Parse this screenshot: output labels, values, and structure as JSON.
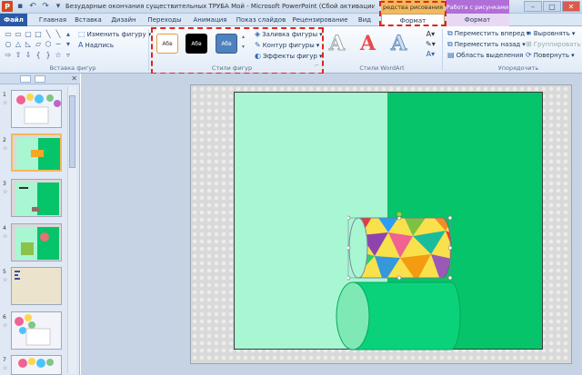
{
  "window": {
    "title": "Безударные окончания существительных ТРУБА  Мой - Microsoft PowerPoint (Сбой активации про...",
    "context_drawing": "редства рисования",
    "context_picture": "Работа с рисунками"
  },
  "tabs": {
    "file": "Файл",
    "home": "Главная",
    "insert": "Вставка",
    "design": "Дизайн",
    "transitions": "Переходы",
    "animation": "Анимация",
    "slideshow": "Показ слайдов",
    "review": "Рецензирование",
    "view": "Вид",
    "format_drawing": "Формат",
    "format_picture": "Формат"
  },
  "ribbon": {
    "insert_shapes": {
      "change_shape": "Изменить фигуру",
      "text_box": "Надпись",
      "label": "Вставка фигур"
    },
    "shape_styles": {
      "style1": "Абв",
      "style2": "Абв",
      "style3": "Абв",
      "fill": "Заливка фигуры",
      "outline": "Контур фигуры",
      "effects": "Эффекты фигур",
      "label": "Стили фигур"
    },
    "wordart": {
      "sample": "A",
      "label": "Стили WordArt"
    },
    "arrange": {
      "bring_forward": "Переместить вперед",
      "send_backward": "Переместить назад",
      "selection_pane": "Область выделения",
      "align": "Выровнять",
      "group": "Группировать",
      "rotate": "Повернуть",
      "label": "Упорядочить"
    }
  },
  "slides_pane": {
    "numbers": [
      "1",
      "2",
      "3",
      "4",
      "5",
      "6",
      "7"
    ],
    "star": "☆"
  },
  "colors": {
    "accent_red": "#e0261d",
    "slide_green_light": "#a8f6d2",
    "slide_green_dark": "#06c469",
    "file_tab": "#2a5aa8"
  }
}
